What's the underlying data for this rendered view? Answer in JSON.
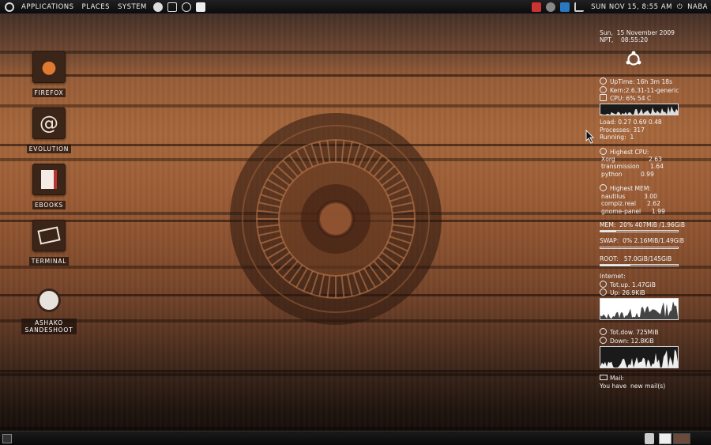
{
  "top_panel": {
    "menus": [
      "Applications",
      "Places",
      "System"
    ],
    "clock": "Sun Nov 15,  8:55 AM",
    "user": "naba"
  },
  "desktop_icons": [
    {
      "label": "Firefox",
      "icon": "firefox-icon",
      "glyph": "🦊"
    },
    {
      "label": "Evolution",
      "icon": "evolution-mail-icon",
      "glyph": "@"
    },
    {
      "label": "eBooks",
      "icon": "ebooks-folder-icon",
      "glyph": "▮"
    },
    {
      "label": "Terminal",
      "icon": "terminal-icon",
      "glyph": "▭"
    },
    {
      "label": "Ashako Sandeshoot",
      "icon": "screenshot-icon",
      "glyph": "◕"
    }
  ],
  "conky": {
    "date": "Sun,  15 November 2009",
    "time": "NPT,    08:55:20",
    "uptime": "UpTime: 16h 3m 18s",
    "kernel": "Kern:2.6.31-11-generic",
    "cpu": "CPU: 6% 54 C",
    "cpu_usage": 0.06,
    "load": "Load: 0.27 0.69 0.48",
    "processes": "Processes: 317",
    "running": "Running:  1",
    "highest_cpu_title": "Highest CPU:",
    "highest_cpu": [
      {
        "name": "Xorg",
        "value": "2.63"
      },
      {
        "name": "transmission",
        "value": "1.64"
      },
      {
        "name": "python",
        "value": "0.99"
      }
    ],
    "highest_mem_title": "Highest MEM:",
    "highest_mem": [
      {
        "name": "nautilus",
        "value": "3.00"
      },
      {
        "name": "compiz.real",
        "value": "2.62"
      },
      {
        "name": "gnome-panel",
        "value": "1.99"
      }
    ],
    "mem": "MEM:  20% 407MiB /1.96GiB",
    "mem_usage": 0.2,
    "swap": "SWAP:  0% 2.16MiB/1.49GiB",
    "swap_usage": 0.0,
    "root": "ROOT:   57.0GiB/145GiB",
    "root_usage": 0.39,
    "internet_title": "Internet:",
    "tot_up": "Tot.up. 1.47GiB",
    "up": "Up: 26.9KiB",
    "tot_down": "Tot.dow. 725MiB",
    "down": "Down: 12.8KiB",
    "mail_title": "Mail:",
    "mail_text": "You have  new mail(s)"
  },
  "colors": {
    "wood_light": "#a8683c",
    "wood_dark": "#3a2418",
    "panel_bg": "#111111"
  }
}
